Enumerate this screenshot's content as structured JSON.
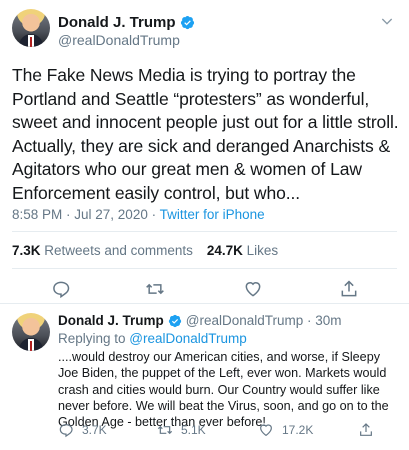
{
  "tweet": {
    "display_name": "Donald J. Trump",
    "handle": "@realDonaldTrump",
    "text": "The Fake News Media is trying to portray the Portland and Seattle “protesters” as wonderful, sweet and innocent people just out for a little stroll. Actually, they are sick and deranged Anarchists & Agitators who our great men & women of Law Enforcement easily control, but who...",
    "time": "8:58 PM · Jul 27, 2020 · ",
    "source": "Twitter for iPhone",
    "retweets_count": "7.3K",
    "retweets_label": "Retweets and comments",
    "likes_count": "24.7K",
    "likes_label": "Likes"
  },
  "reply": {
    "display_name": "Donald J. Trump",
    "handle_time": "@realDonaldTrump · 30m",
    "replying_prefix": "Replying to ",
    "replying_to": "@realDonaldTrump",
    "text": "....would destroy our American cities, and worse, if Sleepy Joe Biden, the puppet of the Left, ever won. Markets would crash and cities would burn. Our Country would suffer like never before. We will beat the Virus, soon, and go on to the Golden Age - better than ever before!",
    "comments": "3.7K",
    "retweets": "5.1K",
    "likes": "17.2K"
  },
  "icons": {
    "verified": "verified-badge-icon",
    "chevron": "chevron-down-icon",
    "reply": "reply-icon",
    "retweet": "retweet-icon",
    "like": "heart-icon",
    "share": "share-icon"
  },
  "colors": {
    "accent": "#1b95e0",
    "secondary_text": "#657786",
    "divider": "#e6ecf0"
  }
}
